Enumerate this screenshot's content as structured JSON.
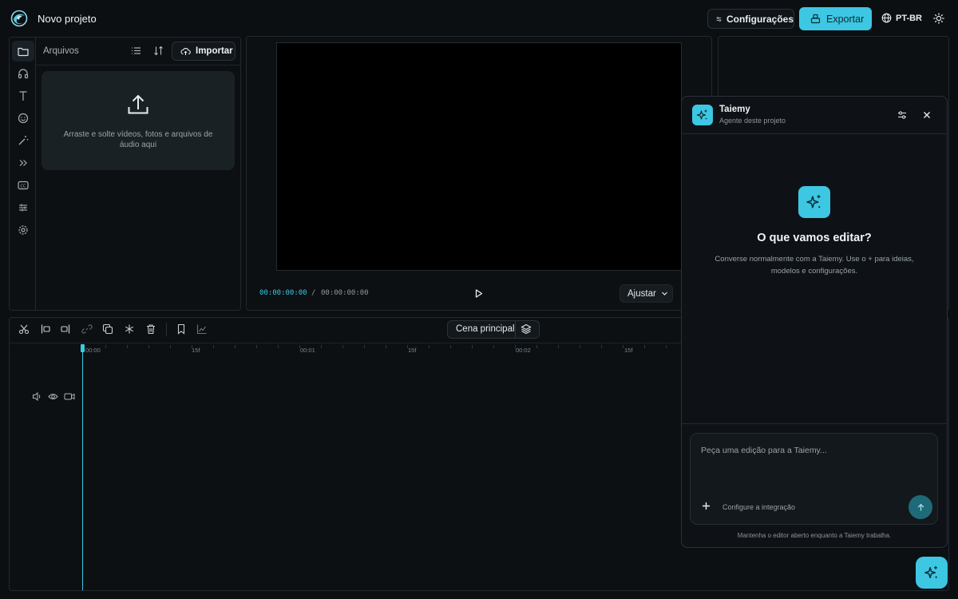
{
  "app": {
    "project_title": "Novo projeto"
  },
  "header": {
    "settings_label": "Configurações",
    "export_label": "Exportar",
    "language": "PT-BR"
  },
  "files": {
    "title": "Arquivos",
    "import_label": "Importar",
    "dropzone_text": "Arraste e solte vídeos, fotos e arquivos de áudio aqui"
  },
  "preview": {
    "current_time": "00:00:00:00",
    "separator": "/",
    "total_time": "00:00:00:00",
    "fit_label": "Ajustar"
  },
  "timeline": {
    "scene_label": "Cena principal",
    "ruler": [
      "00:00",
      "15f",
      "00:01",
      "15f",
      "00:02",
      "15f"
    ]
  },
  "agent": {
    "name": "Taiemy",
    "subtitle": "Agente deste projeto",
    "hero_title": "O que vamos editar?",
    "hero_desc": "Converse normalmente com a Taiemy. Use o + para ideias, modelos e configurações.",
    "input_placeholder": "Peça uma edição para a Taiemy...",
    "integration_label": "Configure a integração",
    "footer": "Mantenha o editor aberto enquanto a Taiemy trabalha."
  },
  "colors": {
    "accent": "#3dc7e3",
    "background": "#0b0f12",
    "panel": "#0c1013"
  },
  "icons": {
    "rail": [
      "folder-icon",
      "headphones-icon",
      "text-icon",
      "smiley-icon",
      "magic-wand-icon",
      "transitions-icon",
      "captions-icon",
      "adjustments-icon",
      "settings-icon"
    ],
    "timeline_tools": [
      "split-icon",
      "trim-left-icon",
      "trim-right-icon",
      "link-icon",
      "duplicate-icon",
      "freeze-icon",
      "delete-icon",
      "bookmark-icon",
      "graph-icon"
    ]
  }
}
